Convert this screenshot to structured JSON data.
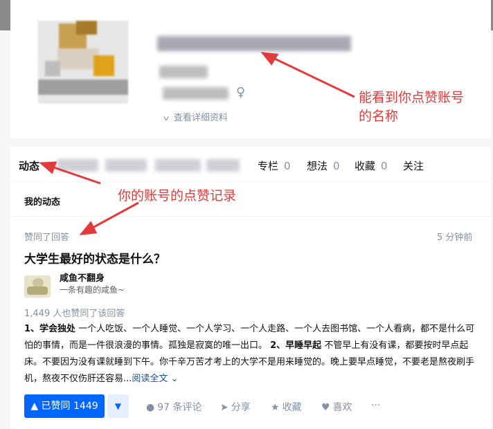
{
  "colors": {
    "accent": "#0066ff",
    "annotation": "#e23b3b",
    "muted": "#8590a6"
  },
  "profile": {
    "gender_icon": "female-icon",
    "gender_symbol": "♀",
    "detail_link": "查看详细资料",
    "detail_icon": "chevron-down-icon"
  },
  "annotations": {
    "name_note": "能看到你点赞账号\n的名称",
    "record_note": "你的账号的点赞记录"
  },
  "tabs": [
    {
      "label": "动态",
      "count": ""
    },
    {
      "label": "专栏",
      "count": "0"
    },
    {
      "label": "想法",
      "count": "0"
    },
    {
      "label": "收藏",
      "count": "0"
    },
    {
      "label": "关注",
      "count": ""
    }
  ],
  "feed": {
    "section_title": "我的动态",
    "item": {
      "action": "赞同了回答",
      "time": "5 分钟前",
      "question": "大学生最好的状态是什么？",
      "author_name": "咸鱼不翻身",
      "author_bio": "一条有趣的咸鱼~",
      "upvote_info": "1,449 人也赞同了该回答",
      "excerpt_part1_bold": "1、学会独处",
      "excerpt_part1": " 一个人吃饭、一个人睡觉、一个人学习、一个人走路、一个人去图书馆、一个人看病，都不是什么可怕的事情，而是一件很浪漫的事情。孤独是寂寞的唯一出口。 ",
      "excerpt_part2_bold": "2、早睡早起",
      "excerpt_part2": " 不管早上有没有课，都要按时早点起床。不要因为没有课就睡到下午。你千辛万苦才考上的大学不是用来睡觉的。晚上要早点睡觉，不要老是熬夜刷手机，熬夜不仅伤肝还容易...",
      "read_more": "阅读全文",
      "read_more_icon": "chevron-down-icon"
    },
    "actions": {
      "voted_label": "▲ 已赞同 1449",
      "vote_down_symbol": "▼",
      "comment": "97 条评论",
      "share": "分享",
      "collect": "收藏",
      "like": "喜欢",
      "more": "···"
    }
  }
}
